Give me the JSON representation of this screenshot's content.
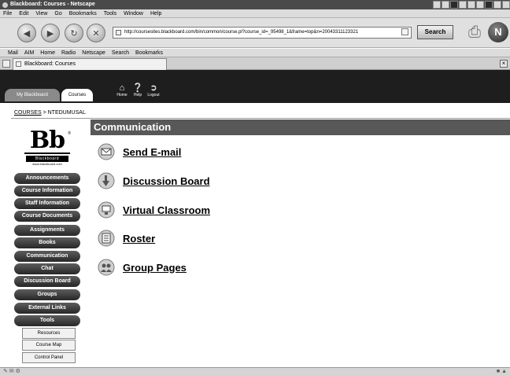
{
  "window": {
    "title": "Blackboard: Courses - Netscape"
  },
  "menubar": {
    "items": [
      "File",
      "Edit",
      "View",
      "Go",
      "Bookmarks",
      "Tools",
      "Window",
      "Help"
    ]
  },
  "navbar": {
    "url": "http://coursesites.blackboard.com/bin/common/course.pl?course_id=_95498_1&frame=top&n=20043311123321",
    "search_label": "Search"
  },
  "bookmarks_bar": {
    "items": [
      "Mail",
      "AIM",
      "Home",
      "Radio",
      "Netscape",
      "Search",
      "Bookmarks"
    ]
  },
  "tabbar": {
    "tab_title": "Blackboard: Courses"
  },
  "bb_header": {
    "tab_my_blackboard": "My Blackboard",
    "tab_courses": "Courses",
    "tool_home": "Home",
    "tool_help": "Help",
    "tool_logout": "Logout"
  },
  "breadcrumb": {
    "root": "COURSES",
    "separator": " > ",
    "current": "NTEDUMUSAL"
  },
  "logo": {
    "mark": "Bb",
    "reg": "®",
    "word": "Blackboard",
    "site": "www.blackboard.com"
  },
  "left_nav": {
    "pills": [
      "Announcements",
      "Course Information",
      "Staff Information",
      "Course Documents",
      "Assignments",
      "Books",
      "Communication",
      "Chat",
      "Discussion Board",
      "Groups",
      "External Links",
      "Tools"
    ],
    "boxes": [
      "Resources",
      "Course Map",
      "Control Panel"
    ]
  },
  "main": {
    "header": "Communication",
    "links": [
      {
        "label": "Send E-mail",
        "icon": "email-icon"
      },
      {
        "label": "Discussion Board",
        "icon": "discussion-board-icon"
      },
      {
        "label": "Virtual Classroom",
        "icon": "virtual-classroom-icon"
      },
      {
        "label": "Roster",
        "icon": "roster-icon"
      },
      {
        "label": "Group Pages",
        "icon": "group-pages-icon"
      }
    ]
  }
}
